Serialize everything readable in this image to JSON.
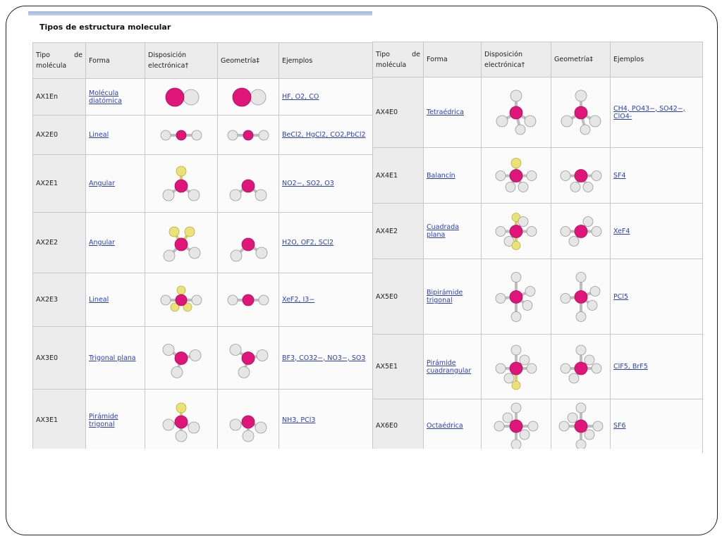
{
  "title": "Tipos de estructura molecular",
  "headers": {
    "tipo_a": "Tipo de",
    "tipo_b": "molécula",
    "forma": "Forma",
    "disp_a": "Disposición",
    "disp_b": "electrónica†",
    "geom": "Geometría‡",
    "ejemplos": "Ejemplos"
  },
  "left_rows": [
    {
      "tipo": "AX1En",
      "forma": "Molécula diatómica",
      "ejemplos": "HF, O2, CO"
    },
    {
      "tipo": "AX2E0",
      "forma": "Lineal",
      "ejemplos": "BeCl2, HgCl2, CO2,PbCl2"
    },
    {
      "tipo": "AX2E1",
      "forma": "Angular",
      "ejemplos": "NO2−, SO2, O3"
    },
    {
      "tipo": "AX2E2",
      "forma": "Angular",
      "ejemplos": "H2O, OF2, SCl2"
    },
    {
      "tipo": "AX2E3",
      "forma": "Lineal",
      "ejemplos": "XeF2, I3−"
    },
    {
      "tipo": "AX3E0",
      "forma": "Trigonal plana",
      "ejemplos": "BF3, CO32−, NO3−, SO3"
    },
    {
      "tipo": "AX3E1",
      "forma": "Pirámide trigonal",
      "ejemplos": "NH3, PCl3"
    }
  ],
  "right_rows": [
    {
      "tipo": "AX4E0",
      "forma": "Tetraédrica",
      "ejemplos": "CH4, PO43−, SO42−, ClO4-"
    },
    {
      "tipo": "AX4E1",
      "forma": "Balancín",
      "ejemplos": "SF4"
    },
    {
      "tipo": "AX4E2",
      "forma": "Cuadrada plana",
      "ejemplos": "XeF4"
    },
    {
      "tipo": "AX5E0",
      "forma": "Bipirámide trigonal",
      "ejemplos": "PCl5"
    },
    {
      "tipo": "AX5E1",
      "forma": "Pirámide cuadrangular",
      "ejemplos": "ClF5, BrF5"
    },
    {
      "tipo": "AX6E0",
      "forma": "Octaédrica",
      "ejemplos": "SF6"
    }
  ],
  "colors": {
    "central_atom": "#e0157a",
    "outer_atom": "#e6e6e6",
    "lone_pair": "#ece27a",
    "link": "#2a3fc4"
  }
}
